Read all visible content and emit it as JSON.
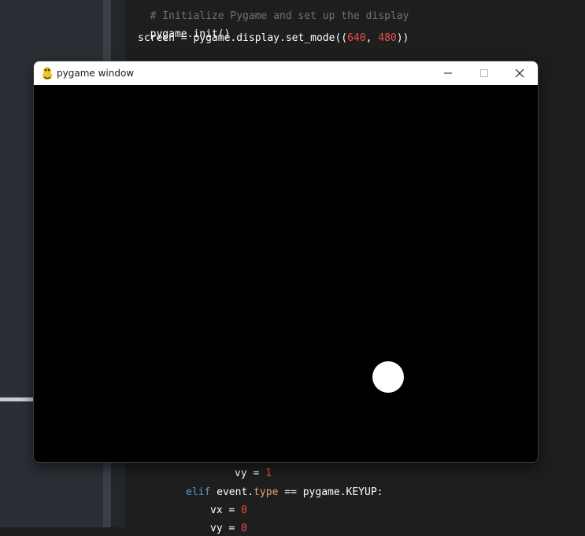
{
  "editor": {
    "top_lines": [
      {
        "comment": "# Initialize Pygame and set up the display"
      },
      {
        "plain": "pygame.init()"
      },
      {
        "pre": "screen = pygame.display.set_mode((",
        "n1": "640",
        "sep": ", ",
        "n2": "480",
        "post": "))"
      }
    ],
    "bottom_lines": [
      {
        "pre": "vy = ",
        "num": "1"
      },
      {
        "kw": "elif",
        "mid": " event.",
        "attr": "type",
        "post": " == pygame.KEYUP:"
      },
      {
        "pre": "vx = ",
        "num": "0"
      },
      {
        "pre": "vy = ",
        "num": "0"
      }
    ]
  },
  "window": {
    "title": "pygame window",
    "icons": {
      "app": "pygame-snake-icon",
      "minimize": "minimize-icon",
      "maximize": "maximize-icon",
      "close": "close-icon"
    },
    "canvas_background": "#000000",
    "ball_color": "#ffffff"
  }
}
